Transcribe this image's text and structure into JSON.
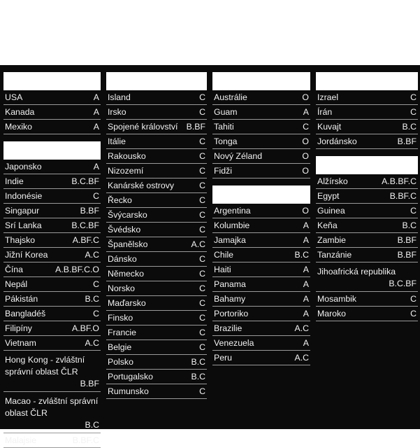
{
  "page": {
    "background": "#ffffff",
    "panel_background": "#0b0b0b",
    "text_color": "#f2f2f2",
    "rule_color": "#9a9a9a",
    "header_box_color": "#ffffff"
  },
  "columns": [
    {
      "id": "column-1",
      "groups": [
        {
          "header_label": "",
          "rows": [
            {
              "name": "USA",
              "code": "A"
            },
            {
              "name": "Kanada",
              "code": "A"
            },
            {
              "name": "Mexiko",
              "code": "A"
            }
          ]
        },
        {
          "header_label": "",
          "rows": [
            {
              "name": "Japonsko",
              "code": "A"
            },
            {
              "name": "Indie",
              "code": "B.C.BF"
            },
            {
              "name": "Indonésie",
              "code": "C"
            },
            {
              "name": "Singapur",
              "code": "B.BF"
            },
            {
              "name": "Srí Lanka",
              "code": "B.C.BF"
            },
            {
              "name": "Thajsko",
              "code": "A.BF.C"
            },
            {
              "name": "Jižní Korea",
              "code": "A.C"
            },
            {
              "name": "Čína",
              "code": "A.B.BF.C.O"
            },
            {
              "name": "Nepál",
              "code": "C"
            },
            {
              "name": "Pákistán",
              "code": "B.C"
            },
            {
              "name": "Bangladéš",
              "code": "C"
            },
            {
              "name": "Filipíny",
              "code": "A.BF.O"
            },
            {
              "name": "Vietnam",
              "code": "A.C"
            },
            {
              "name": "Hong Kong - zvláštní správní oblast ČLR",
              "code": "B.BF",
              "multiline": true
            },
            {
              "name": "Macao - zvláštní správní oblast ČLR",
              "code": "B.C",
              "multiline": true
            },
            {
              "name": "Malajsie",
              "code": "B.BF.C"
            }
          ]
        }
      ]
    },
    {
      "id": "column-2",
      "groups": [
        {
          "header_label": "",
          "rows": [
            {
              "name": "Island",
              "code": "C"
            },
            {
              "name": "Irsko",
              "code": "C"
            },
            {
              "name": "Spojené království",
              "code": "B.BF"
            },
            {
              "name": "Itálie",
              "code": "C"
            },
            {
              "name": "Rakousko",
              "code": "C"
            },
            {
              "name": "Nizozemí",
              "code": "C"
            },
            {
              "name": "Kanárské ostrovy",
              "code": "C"
            },
            {
              "name": "Řecko",
              "code": "C"
            },
            {
              "name": "Švýcarsko",
              "code": "C"
            },
            {
              "name": "Švédsko",
              "code": "C"
            },
            {
              "name": "Španělsko",
              "code": "A.C"
            },
            {
              "name": "Dánsko",
              "code": "C"
            },
            {
              "name": "Německo",
              "code": "C"
            },
            {
              "name": "Norsko",
              "code": "C"
            },
            {
              "name": "Maďarsko",
              "code": "C"
            },
            {
              "name": "Finsko",
              "code": "C"
            },
            {
              "name": "Francie",
              "code": "C"
            },
            {
              "name": "Belgie",
              "code": "C"
            },
            {
              "name": "Polsko",
              "code": "B.C"
            },
            {
              "name": "Portugalsko",
              "code": "B.C"
            },
            {
              "name": "Rumunsko",
              "code": "C"
            }
          ]
        }
      ]
    },
    {
      "id": "column-3",
      "groups": [
        {
          "header_label": "",
          "rows": [
            {
              "name": "Austrálie",
              "code": "O"
            },
            {
              "name": "Guam",
              "code": "A"
            },
            {
              "name": "Tahiti",
              "code": "C"
            },
            {
              "name": "Tonga",
              "code": "O"
            },
            {
              "name": "Nový Zéland",
              "code": "O"
            },
            {
              "name": "Fidži",
              "code": "O"
            }
          ]
        },
        {
          "header_label": "",
          "rows": [
            {
              "name": "Argentina",
              "code": "O"
            },
            {
              "name": "Kolumbie",
              "code": "A"
            },
            {
              "name": "Jamajka",
              "code": "A"
            },
            {
              "name": "Chile",
              "code": "B.C"
            },
            {
              "name": "Haiti",
              "code": "A"
            },
            {
              "name": "Panama",
              "code": "A"
            },
            {
              "name": "Bahamy",
              "code": "A"
            },
            {
              "name": "Portoriko",
              "code": "A"
            },
            {
              "name": "Brazilie",
              "code": "A.C"
            },
            {
              "name": "Venezuela",
              "code": "A"
            },
            {
              "name": "Peru",
              "code": "A.C"
            }
          ]
        }
      ]
    },
    {
      "id": "column-4",
      "groups": [
        {
          "header_label": "",
          "rows": [
            {
              "name": "Izrael",
              "code": "C"
            },
            {
              "name": "Írán",
              "code": "C"
            },
            {
              "name": "Kuvajt",
              "code": "B.C"
            },
            {
              "name": "Jordánsko",
              "code": "B.BF"
            }
          ]
        },
        {
          "header_label": "",
          "rows": [
            {
              "name": "Alžírsko",
              "code": "A.B.BF.C"
            },
            {
              "name": "Egypt",
              "code": "B.BF.C"
            },
            {
              "name": "Guinea",
              "code": "C"
            },
            {
              "name": "Keňa",
              "code": "B.C"
            },
            {
              "name": "Zambie",
              "code": "B.BF"
            },
            {
              "name": "Tanzánie",
              "code": "B.BF"
            },
            {
              "name": "Jihoafrická republika",
              "code": "B.C.BF",
              "multiline": true
            },
            {
              "name": "Mosambik",
              "code": "C"
            },
            {
              "name": "Maroko",
              "code": "C"
            }
          ]
        }
      ]
    }
  ]
}
